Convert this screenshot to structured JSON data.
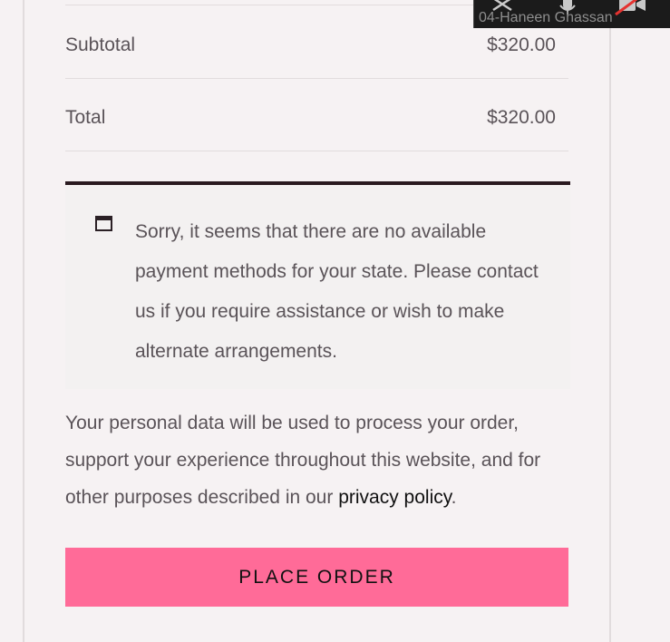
{
  "summary": {
    "subtotal_label": "Subtotal",
    "subtotal_value": "$320.00",
    "total_label": "Total",
    "total_value": "$320.00"
  },
  "notice": {
    "message": "Sorry, it seems that there are no available payment methods for your state. Please contact us if you require assistance or wish to make alternate arrangements."
  },
  "privacy": {
    "text_before": "Your personal data will be used to process your order, support your experience throughout this website, and for other purposes described in our ",
    "link_text": "privacy policy",
    "text_after": "."
  },
  "place_order_label": "PLACE ORDER",
  "video_overlay": {
    "participant_name": "04-Haneen Ghassan",
    "icons": [
      "close-icon",
      "microphone-icon",
      "video-off-icon"
    ]
  },
  "colors": {
    "page_bg": "#f6f2f3",
    "button_bg": "#ff6b98",
    "notice_border": "#2a1a20",
    "overlay_bg": "#1b1b1b"
  }
}
